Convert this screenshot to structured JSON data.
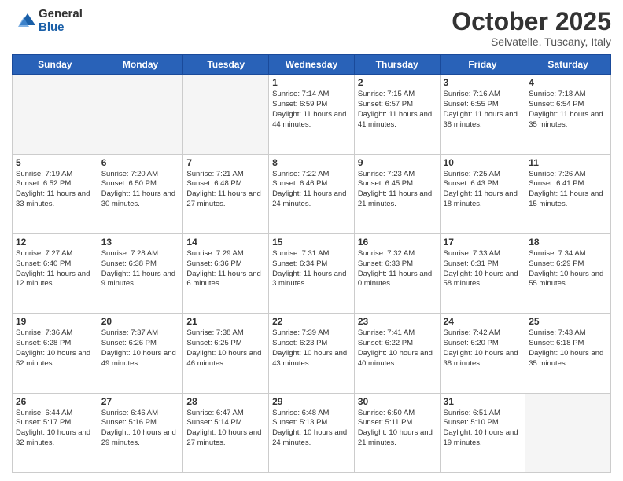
{
  "logo": {
    "general": "General",
    "blue": "Blue"
  },
  "header": {
    "month": "October 2025",
    "location": "Selvatelle, Tuscany, Italy"
  },
  "days_of_week": [
    "Sunday",
    "Monday",
    "Tuesday",
    "Wednesday",
    "Thursday",
    "Friday",
    "Saturday"
  ],
  "weeks": [
    [
      {
        "day": "",
        "info": ""
      },
      {
        "day": "",
        "info": ""
      },
      {
        "day": "",
        "info": ""
      },
      {
        "day": "1",
        "info": "Sunrise: 7:14 AM\nSunset: 6:59 PM\nDaylight: 11 hours\nand 44 minutes."
      },
      {
        "day": "2",
        "info": "Sunrise: 7:15 AM\nSunset: 6:57 PM\nDaylight: 11 hours\nand 41 minutes."
      },
      {
        "day": "3",
        "info": "Sunrise: 7:16 AM\nSunset: 6:55 PM\nDaylight: 11 hours\nand 38 minutes."
      },
      {
        "day": "4",
        "info": "Sunrise: 7:18 AM\nSunset: 6:54 PM\nDaylight: 11 hours\nand 35 minutes."
      }
    ],
    [
      {
        "day": "5",
        "info": "Sunrise: 7:19 AM\nSunset: 6:52 PM\nDaylight: 11 hours\nand 33 minutes."
      },
      {
        "day": "6",
        "info": "Sunrise: 7:20 AM\nSunset: 6:50 PM\nDaylight: 11 hours\nand 30 minutes."
      },
      {
        "day": "7",
        "info": "Sunrise: 7:21 AM\nSunset: 6:48 PM\nDaylight: 11 hours\nand 27 minutes."
      },
      {
        "day": "8",
        "info": "Sunrise: 7:22 AM\nSunset: 6:46 PM\nDaylight: 11 hours\nand 24 minutes."
      },
      {
        "day": "9",
        "info": "Sunrise: 7:23 AM\nSunset: 6:45 PM\nDaylight: 11 hours\nand 21 minutes."
      },
      {
        "day": "10",
        "info": "Sunrise: 7:25 AM\nSunset: 6:43 PM\nDaylight: 11 hours\nand 18 minutes."
      },
      {
        "day": "11",
        "info": "Sunrise: 7:26 AM\nSunset: 6:41 PM\nDaylight: 11 hours\nand 15 minutes."
      }
    ],
    [
      {
        "day": "12",
        "info": "Sunrise: 7:27 AM\nSunset: 6:40 PM\nDaylight: 11 hours\nand 12 minutes."
      },
      {
        "day": "13",
        "info": "Sunrise: 7:28 AM\nSunset: 6:38 PM\nDaylight: 11 hours\nand 9 minutes."
      },
      {
        "day": "14",
        "info": "Sunrise: 7:29 AM\nSunset: 6:36 PM\nDaylight: 11 hours\nand 6 minutes."
      },
      {
        "day": "15",
        "info": "Sunrise: 7:31 AM\nSunset: 6:34 PM\nDaylight: 11 hours\nand 3 minutes."
      },
      {
        "day": "16",
        "info": "Sunrise: 7:32 AM\nSunset: 6:33 PM\nDaylight: 11 hours\nand 0 minutes."
      },
      {
        "day": "17",
        "info": "Sunrise: 7:33 AM\nSunset: 6:31 PM\nDaylight: 10 hours\nand 58 minutes."
      },
      {
        "day": "18",
        "info": "Sunrise: 7:34 AM\nSunset: 6:29 PM\nDaylight: 10 hours\nand 55 minutes."
      }
    ],
    [
      {
        "day": "19",
        "info": "Sunrise: 7:36 AM\nSunset: 6:28 PM\nDaylight: 10 hours\nand 52 minutes."
      },
      {
        "day": "20",
        "info": "Sunrise: 7:37 AM\nSunset: 6:26 PM\nDaylight: 10 hours\nand 49 minutes."
      },
      {
        "day": "21",
        "info": "Sunrise: 7:38 AM\nSunset: 6:25 PM\nDaylight: 10 hours\nand 46 minutes."
      },
      {
        "day": "22",
        "info": "Sunrise: 7:39 AM\nSunset: 6:23 PM\nDaylight: 10 hours\nand 43 minutes."
      },
      {
        "day": "23",
        "info": "Sunrise: 7:41 AM\nSunset: 6:22 PM\nDaylight: 10 hours\nand 40 minutes."
      },
      {
        "day": "24",
        "info": "Sunrise: 7:42 AM\nSunset: 6:20 PM\nDaylight: 10 hours\nand 38 minutes."
      },
      {
        "day": "25",
        "info": "Sunrise: 7:43 AM\nSunset: 6:18 PM\nDaylight: 10 hours\nand 35 minutes."
      }
    ],
    [
      {
        "day": "26",
        "info": "Sunrise: 6:44 AM\nSunset: 5:17 PM\nDaylight: 10 hours\nand 32 minutes."
      },
      {
        "day": "27",
        "info": "Sunrise: 6:46 AM\nSunset: 5:16 PM\nDaylight: 10 hours\nand 29 minutes."
      },
      {
        "day": "28",
        "info": "Sunrise: 6:47 AM\nSunset: 5:14 PM\nDaylight: 10 hours\nand 27 minutes."
      },
      {
        "day": "29",
        "info": "Sunrise: 6:48 AM\nSunset: 5:13 PM\nDaylight: 10 hours\nand 24 minutes."
      },
      {
        "day": "30",
        "info": "Sunrise: 6:50 AM\nSunset: 5:11 PM\nDaylight: 10 hours\nand 21 minutes."
      },
      {
        "day": "31",
        "info": "Sunrise: 6:51 AM\nSunset: 5:10 PM\nDaylight: 10 hours\nand 19 minutes."
      },
      {
        "day": "",
        "info": ""
      }
    ]
  ]
}
